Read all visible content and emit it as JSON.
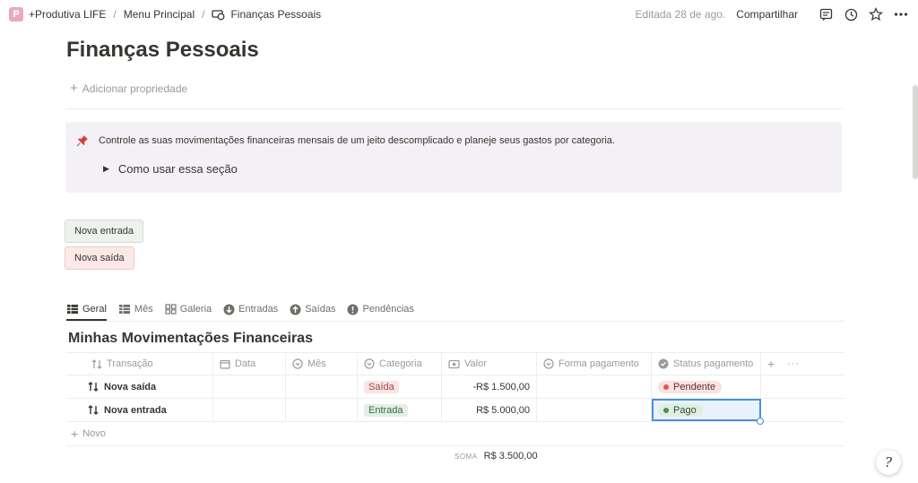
{
  "breadcrumb": {
    "logo_letter": "P",
    "items": [
      "+Produtiva LIFE",
      "Menu Principal",
      "Finanças Pessoais"
    ]
  },
  "topbar": {
    "edited": "Editada 28 de ago.",
    "share": "Compartilhar",
    "icons": [
      "comment-icon",
      "clock-icon",
      "star-icon",
      "more-icon"
    ]
  },
  "page": {
    "title": "Finanças Pessoais",
    "add_property": "Adicionar propriedade"
  },
  "callout": {
    "icon": "pushpin-icon",
    "text": "Controle as suas movimentações financeiras mensais de um jeito descomplicado e planeje seus gastos por categoria.",
    "toggle_label": "Como usar essa seção"
  },
  "buttons": {
    "new_entry": "Nova entrada",
    "new_exit": "Nova saída"
  },
  "tabs": [
    {
      "label": "Geral",
      "icon": "table-icon",
      "active": true
    },
    {
      "label": "Mês",
      "icon": "table-icon",
      "active": false
    },
    {
      "label": "Galeria",
      "icon": "gallery-icon",
      "active": false
    },
    {
      "label": "Entradas",
      "icon": "arrow-down-circle-icon",
      "active": false
    },
    {
      "label": "Saídas",
      "icon": "arrow-up-circle-icon",
      "active": false
    },
    {
      "label": "Pendências",
      "icon": "alert-circle-icon",
      "active": false
    }
  ],
  "database": {
    "title": "Minhas Movimentações Financeiras",
    "columns": [
      "Transação",
      "Data",
      "Mês",
      "Categoria",
      "Valor",
      "Forma pagamento",
      "Status pagamento"
    ],
    "add_column": "+",
    "more": "···",
    "rows": [
      {
        "name": "Nova saída",
        "data": "",
        "mes": "",
        "categoria": "Saída",
        "valor": "-R$ 1.500,00",
        "forma": "",
        "status": "Pendente"
      },
      {
        "name": "Nova entrada",
        "data": "",
        "mes": "",
        "categoria": "Entrada",
        "valor": "R$ 5.000,00",
        "forma": "",
        "status": "Pago"
      }
    ],
    "new_row": "Novo",
    "sum_label": "SOMA",
    "sum_value": "R$ 3.500,00"
  },
  "colors": {
    "saida_tag": "#fbe4e4",
    "entrada_tag": "#e3efe4",
    "pendente_dot": "#d9585b",
    "pago_dot": "#4e8b5a",
    "selection": "#4a90d9"
  },
  "help": {
    "glyph": "?"
  }
}
